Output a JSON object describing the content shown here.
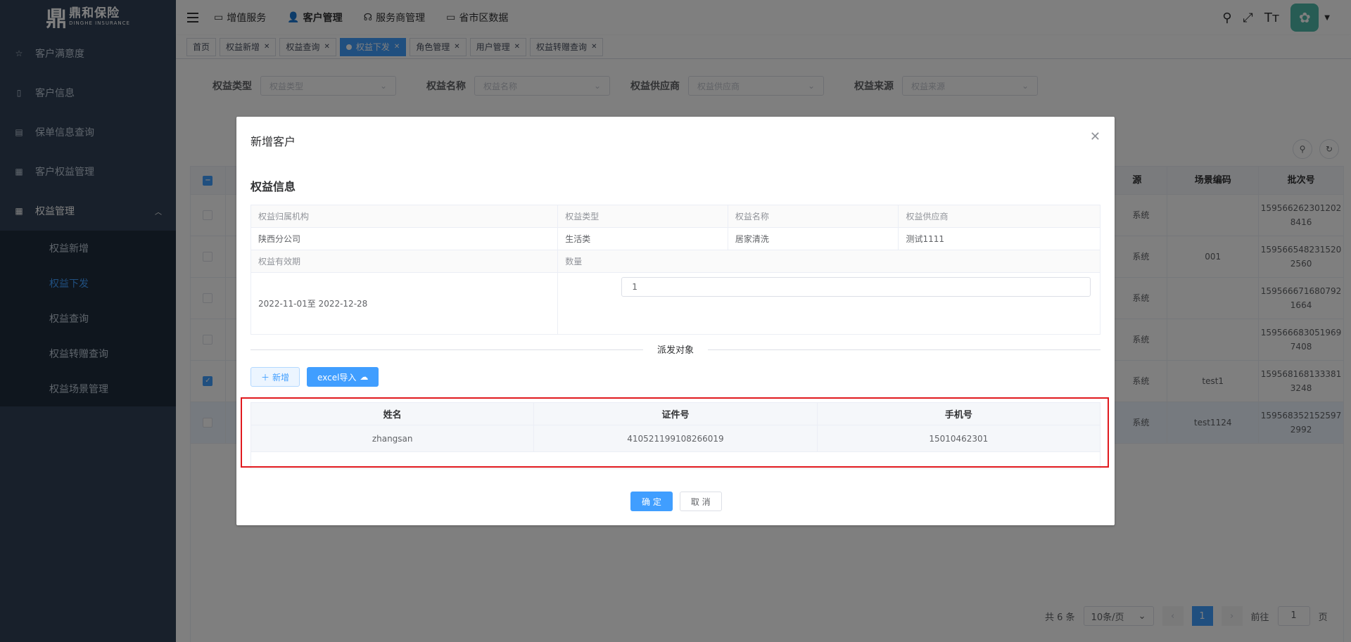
{
  "logo": {
    "mark": "鼎",
    "cn": "鼎和保险",
    "en": "DINGHE INSURANCE"
  },
  "sidebar": {
    "items": [
      {
        "label": "客户满意度",
        "icon": "☆"
      },
      {
        "label": "客户信息",
        "icon": "▯"
      },
      {
        "label": "保单信息查询",
        "icon": "▤"
      },
      {
        "label": "客户权益管理",
        "icon": "▦"
      }
    ],
    "parent": {
      "label": "权益管理",
      "icon": "▦"
    },
    "subitems": [
      "权益新增",
      "权益下发",
      "权益查询",
      "权益转赠查询",
      "权益场景管理"
    ]
  },
  "topnav": {
    "items": [
      "增值服务",
      "客户管理",
      "服务商管理",
      "省市区数据"
    ]
  },
  "tags": [
    "首页",
    "权益新增",
    "权益查询",
    "权益下发",
    "角色管理",
    "用户管理",
    "权益转赠查询"
  ],
  "filters": {
    "row1": [
      {
        "label": "权益类型",
        "placeholder": "权益类型"
      },
      {
        "label": "权益名称",
        "placeholder": "权益名称"
      },
      {
        "label": "权益供应商",
        "placeholder": "权益供应商"
      },
      {
        "label": "权益来源",
        "placeholder": "权益来源"
      }
    ]
  },
  "bg_table": {
    "headers": [
      "源",
      "场景编码",
      "批次号"
    ],
    "rows": [
      {
        "src": "系统",
        "scene": "",
        "batch": "1595662623012028416",
        "checked": false
      },
      {
        "src": "系统",
        "scene": "001",
        "batch": "1595665482315202560",
        "checked": false
      },
      {
        "src": "系统",
        "scene": "",
        "batch": "1595666716807921664",
        "checked": false
      },
      {
        "src": "系统",
        "scene": "",
        "batch": "1595666830519697408",
        "checked": false
      },
      {
        "src": "系统",
        "scene": "test1",
        "batch": "1595681681333813248",
        "checked": true
      },
      {
        "src": "系统",
        "scene": "test1124",
        "batch": "1595683521525972992",
        "checked": false
      }
    ]
  },
  "pagination": {
    "total": "共 6 条",
    "size": "10条/页",
    "page": "1",
    "goto": "前往",
    "goto_value": "1",
    "page_unit": "页"
  },
  "modal": {
    "title": "新增客户",
    "section": "权益信息",
    "desc": {
      "org_label": "权益归属机构",
      "org": "陕西分公司",
      "type_label": "权益类型",
      "type": "生活类",
      "name_label": "权益名称",
      "name": "居家清洗",
      "supplier_label": "权益供应商",
      "supplier": "测试1111",
      "validity_label": "权益有效期",
      "validity": "2022-11-01至 2022-12-28",
      "qty_label": "数量",
      "qty": "1"
    },
    "divider": "派发对象",
    "add_label": "新增",
    "import_label": "excel导入",
    "table": {
      "headers": [
        "姓名",
        "证件号",
        "手机号"
      ],
      "rows": [
        [
          "zhangsan",
          "410521199108266019",
          "15010462301"
        ]
      ]
    },
    "ok": "确 定",
    "cancel": "取 消"
  },
  "colors": {
    "primary": "#409eff",
    "sidebar": "#304156",
    "highlight": "#e0191e"
  }
}
